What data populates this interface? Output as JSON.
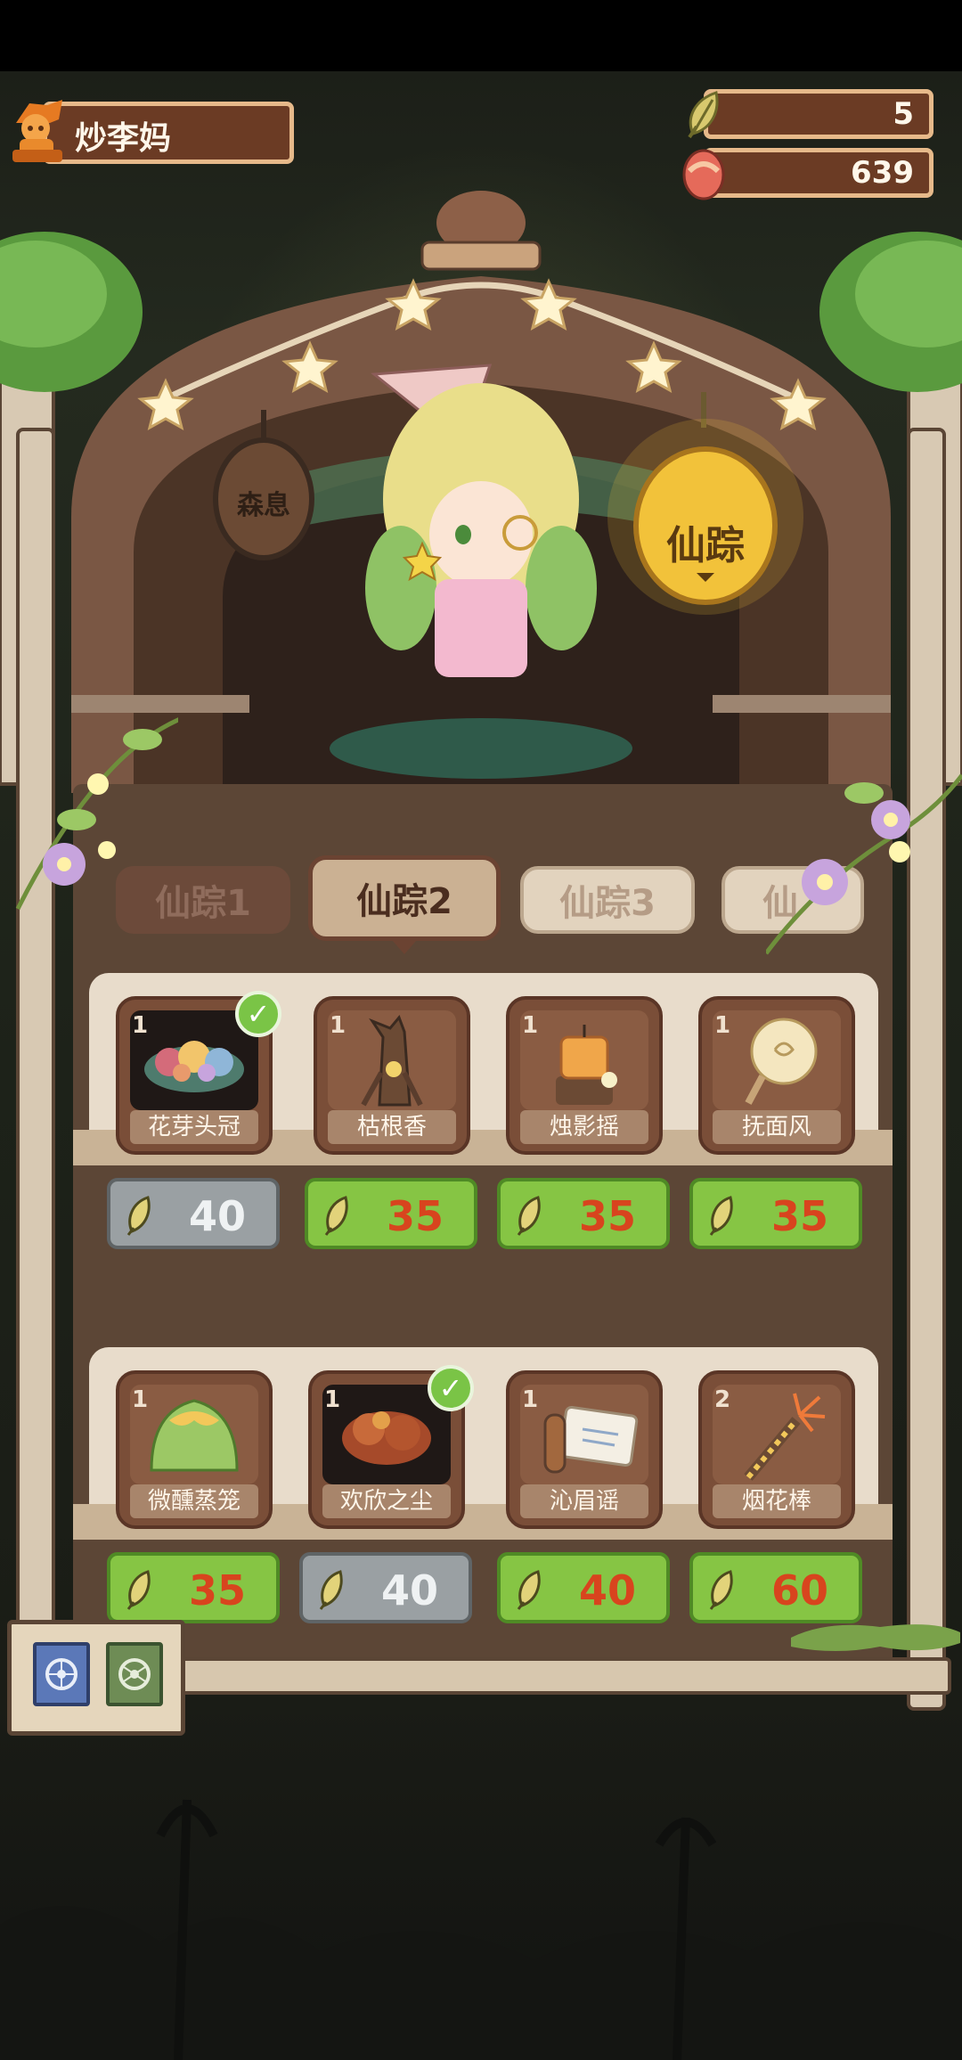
{
  "player": {
    "name": "炒李妈"
  },
  "currency": {
    "leaves": "5",
    "eggs": "639"
  },
  "hut": {
    "sign_left": "森息",
    "sign_right": "仙踪"
  },
  "tabs": [
    {
      "label": "仙踪1",
      "state": "inactive"
    },
    {
      "label": "仙踪2",
      "state": "active"
    },
    {
      "label": "仙踪3",
      "state": "light"
    },
    {
      "label": "仙",
      "state": "light"
    }
  ],
  "shelves": [
    {
      "items": [
        {
          "count": "1",
          "name": "花芽头冠",
          "owned": true,
          "price": "40",
          "price_state": "gray",
          "icon": "flower-crown-icon"
        },
        {
          "count": "1",
          "name": "枯根香",
          "owned": false,
          "price": "35",
          "price_state": "green",
          "icon": "root-incense-icon"
        },
        {
          "count": "1",
          "name": "烛影摇",
          "owned": false,
          "price": "35",
          "price_state": "green",
          "icon": "candle-icon"
        },
        {
          "count": "1",
          "name": "抚面风",
          "owned": false,
          "price": "35",
          "price_state": "green",
          "icon": "hand-fan-icon"
        }
      ]
    },
    {
      "items": [
        {
          "count": "1",
          "name": "微醺蒸笼",
          "owned": false,
          "price": "35",
          "price_state": "green",
          "icon": "steamer-bun-icon"
        },
        {
          "count": "1",
          "name": "欢欣之尘",
          "owned": true,
          "price": "40",
          "price_state": "gray",
          "icon": "dust-cloud-icon"
        },
        {
          "count": "1",
          "name": "沁眉谣",
          "owned": false,
          "price": "40",
          "price_state": "green",
          "icon": "scroll-icon"
        },
        {
          "count": "2",
          "name": "烟花棒",
          "owned": false,
          "price": "60",
          "price_state": "green",
          "icon": "sparkler-icon"
        }
      ]
    }
  ],
  "colors": {
    "price_green": "#86c544",
    "price_gray": "#9aa0a3",
    "price_text": "#d8441e",
    "panel": "#5c4636",
    "sign_glow": "#f2c23a"
  }
}
